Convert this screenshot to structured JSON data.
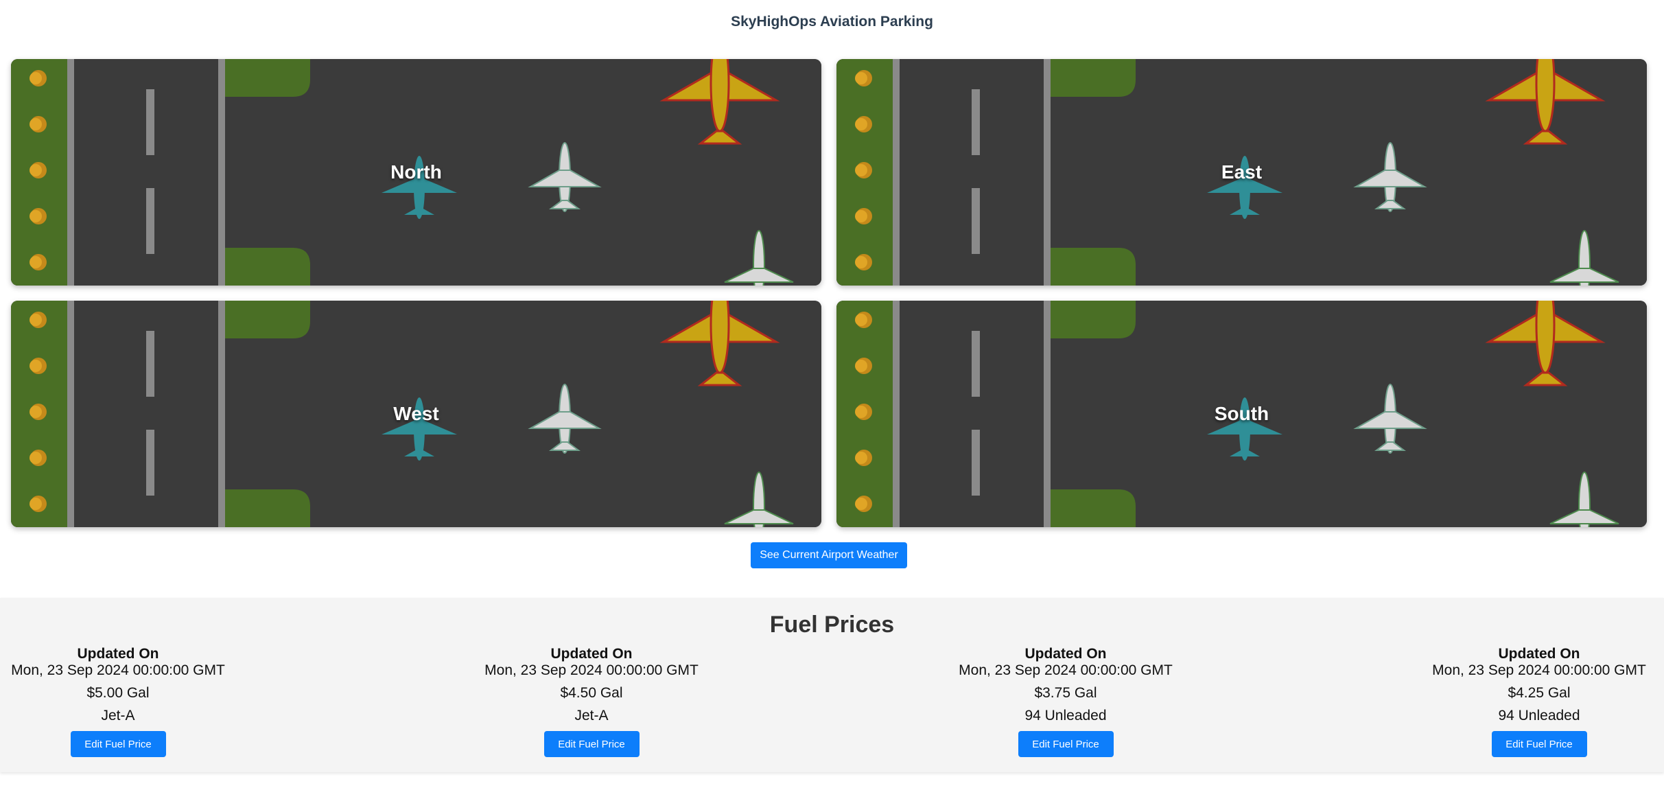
{
  "app": {
    "title": "SkyHighOps Aviation Parking"
  },
  "colors": {
    "accent": "#0d7efb",
    "tarmac": "#3b3b3b",
    "grass": "#4a6f25"
  },
  "parking_areas": [
    {
      "label": "North"
    },
    {
      "label": "East"
    },
    {
      "label": "West"
    },
    {
      "label": "South"
    }
  ],
  "weather_button": {
    "label": "See Current Airport Weather"
  },
  "fuel": {
    "heading": "Fuel Prices",
    "items": [
      {
        "updated_label": "Updated On",
        "date": "Mon, 23 Sep 2024 00:00:00 GMT",
        "price": "$5.00 Gal",
        "type": "Jet-A",
        "button": "Edit Fuel Price"
      },
      {
        "updated_label": "Updated On",
        "date": "Mon, 23 Sep 2024 00:00:00 GMT",
        "price": "$4.50 Gal",
        "type": "Jet-A",
        "button": "Edit Fuel Price"
      },
      {
        "updated_label": "Updated On",
        "date": "Mon, 23 Sep 2024 00:00:00 GMT",
        "price": "$3.75 Gal",
        "type": "94 Unleaded",
        "button": "Edit Fuel Price"
      },
      {
        "updated_label": "Updated On",
        "date": "Mon, 23 Sep 2024 00:00:00 GMT",
        "price": "$4.25 Gal",
        "type": "94 Unleaded",
        "button": "Edit Fuel Price"
      }
    ]
  }
}
